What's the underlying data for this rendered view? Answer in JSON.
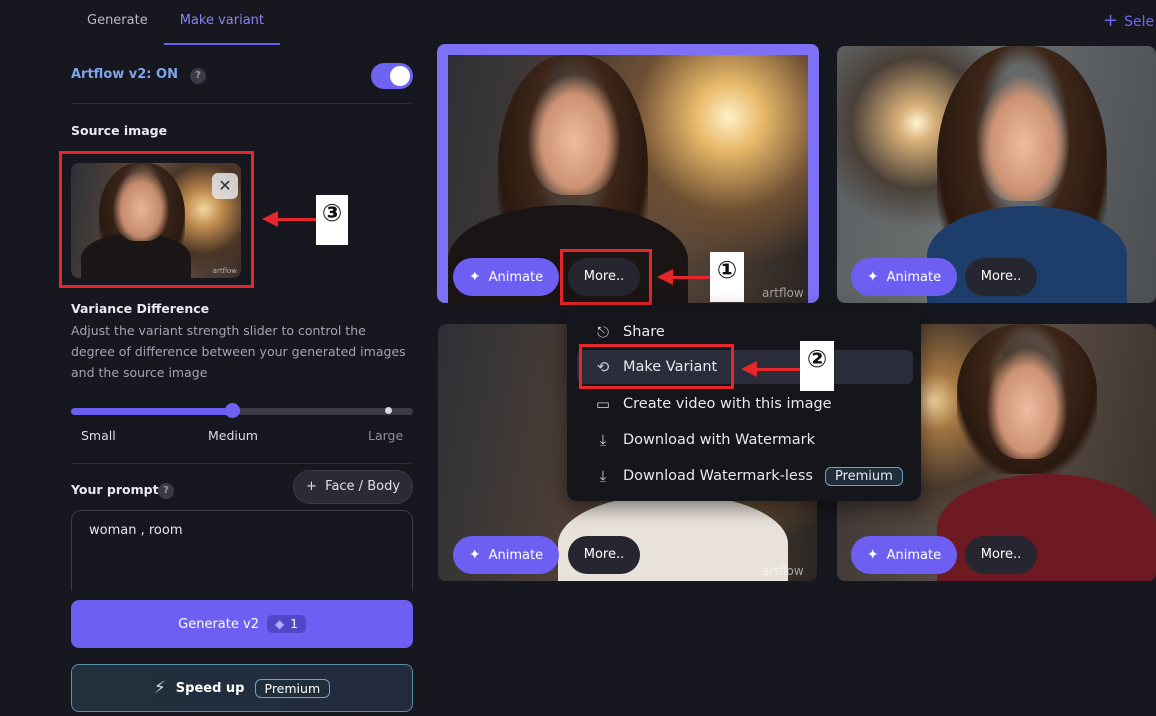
{
  "tabs": [
    {
      "label": "Generate"
    },
    {
      "label": "Make variant"
    }
  ],
  "header": {
    "select_label": "Sele"
  },
  "left": {
    "artflow_label": "Artflow v2: ON",
    "source_title": "Source image",
    "variance_title": "Variance Difference",
    "variance_desc": "Adjust the variant strength slider to control the degree of difference between your generated images and the source image",
    "slider": {
      "value": 0.47,
      "labels": [
        "Small",
        "Medium",
        "Large"
      ]
    },
    "prompt_label": "Your prompt",
    "face_body_label": "Face / Body",
    "prompt_value": "woman , room",
    "generate_label": "Generate v2",
    "generate_credits": "1",
    "speed_label": "Speed up",
    "premium_label": "Premium",
    "thumb_watermark": "artflow"
  },
  "cards": [
    {
      "animate": "Animate",
      "more": "More.."
    },
    {
      "animate": "Animate",
      "more": "More.."
    },
    {
      "animate": "Animate",
      "more": "More.."
    },
    {
      "animate": "Animate",
      "more": "More.."
    }
  ],
  "watermark": "artflow",
  "menu": {
    "items": [
      {
        "label": "Share",
        "icon": "share-icon"
      },
      {
        "label": "Make Variant",
        "icon": "variant-icon"
      },
      {
        "label": "Create video with this image",
        "icon": "video-icon"
      },
      {
        "label": "Download with Watermark",
        "icon": "download-icon"
      },
      {
        "label": "Download Watermark-less",
        "icon": "download-icon"
      }
    ],
    "premium_label": "Premium"
  },
  "annotations": [
    "①",
    "②",
    "③"
  ],
  "colors": {
    "accent": "#6c5ff2",
    "annotation": "#e5262b",
    "artflow_label": "#7ea6e8"
  }
}
